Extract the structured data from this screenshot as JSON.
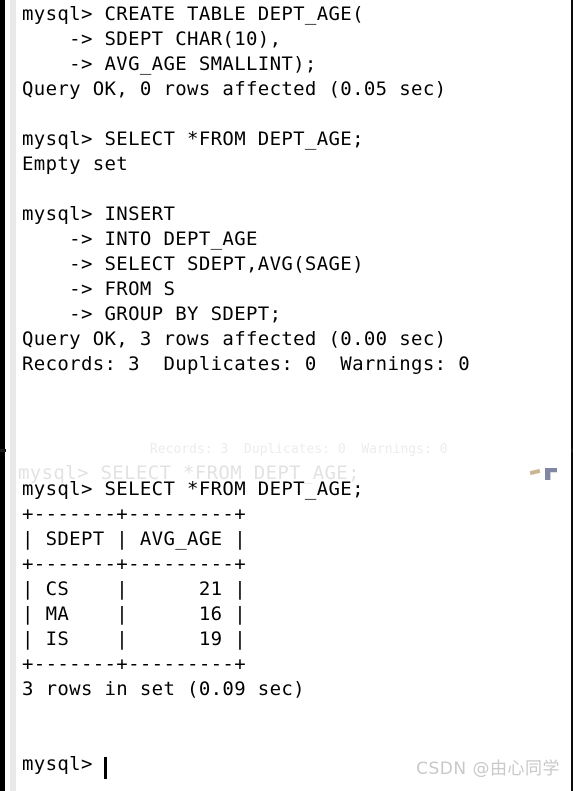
{
  "window": {
    "type": "mysql-command-line-terminal",
    "background_color": "#ffffff",
    "text_color": "#000000",
    "left_edge_color": "#000000",
    "gutter_color": "#e9e9ea",
    "right_edge_color": "#0c0c0c"
  },
  "terminal": {
    "prompt": "mysql>",
    "continuation_prompt": "->",
    "lines": [
      {
        "id": "l1",
        "text": "mysql> CREATE TABLE DEPT_AGE("
      },
      {
        "id": "l2",
        "text": "    -> SDEPT CHAR(10),"
      },
      {
        "id": "l3",
        "text": "    -> AVG_AGE SMALLINT);"
      },
      {
        "id": "l4",
        "text": "Query OK, 0 rows affected (0.05 sec)"
      },
      {
        "id": "l5",
        "text": ""
      },
      {
        "id": "l6",
        "text": "mysql> SELECT *FROM DEPT_AGE;"
      },
      {
        "id": "l7",
        "text": "Empty set"
      },
      {
        "id": "l8",
        "text": ""
      },
      {
        "id": "l9",
        "text": "mysql> INSERT"
      },
      {
        "id": "l10",
        "text": "    -> INTO DEPT_AGE"
      },
      {
        "id": "l11",
        "text": "    -> SELECT SDEPT,AVG(SAGE)"
      },
      {
        "id": "l12",
        "text": "    -> FROM S"
      },
      {
        "id": "l13",
        "text": "    -> GROUP BY SDEPT;"
      },
      {
        "id": "l14",
        "text": "Query OK, 3 rows affected (0.00 sec)"
      },
      {
        "id": "l15",
        "text": "Records: 3  Duplicates: 0  Warnings: 0"
      },
      {
        "id": "l16",
        "text": ""
      },
      {
        "id": "l17",
        "text": ""
      },
      {
        "id": "l18",
        "text": ""
      },
      {
        "id": "l19",
        "text": "mysql> SELECT *FROM DEPT_AGE;"
      },
      {
        "id": "l20",
        "text": "+-------+---------+"
      },
      {
        "id": "l21",
        "text": "| SDEPT | AVG_AGE |"
      },
      {
        "id": "l22",
        "text": "+-------+---------+"
      },
      {
        "id": "l23",
        "text": "| CS    |      21 |"
      },
      {
        "id": "l24",
        "text": "| MA    |      16 |"
      },
      {
        "id": "l25",
        "text": "| IS    |      19 |"
      },
      {
        "id": "l26",
        "text": "+-------+---------+"
      },
      {
        "id": "l27",
        "text": "3 rows in set (0.09 sec)"
      },
      {
        "id": "l28",
        "text": ""
      },
      {
        "id": "l29",
        "text": "mysql>"
      }
    ],
    "result_table": {
      "headers": [
        "SDEPT",
        "AVG_AGE"
      ],
      "rows": [
        [
          "CS",
          "21"
        ],
        [
          "MA",
          "16"
        ],
        [
          "IS",
          "19"
        ]
      ],
      "row_count_text": "3 rows in set (0.09 sec)"
    },
    "statements": [
      {
        "sql": "CREATE TABLE DEPT_AGE( SDEPT CHAR(10), AVG_AGE SMALLINT);",
        "result": "Query OK, 0 rows affected (0.05 sec)"
      },
      {
        "sql": "SELECT *FROM DEPT_AGE;",
        "result": "Empty set"
      },
      {
        "sql": "INSERT INTO DEPT_AGE SELECT SDEPT,AVG(SAGE) FROM S GROUP BY SDEPT;",
        "result": "Query OK, 3 rows affected (0.00 sec)",
        "result_extra": "Records: 3  Duplicates: 0  Warnings: 0"
      },
      {
        "sql": "SELECT *FROM DEPT_AGE;",
        "result": "3 rows in set (0.09 sec)"
      }
    ],
    "cursor_visible": true
  },
  "seam": {
    "ghost_text_1": "Records: 3  Duplicates: 0  Warnings: 0",
    "ghost_text_2": "mysql> SELECT *FROM DEPT_AGE;"
  },
  "watermark": {
    "text": "CSDN @由心同学",
    "color": "#c9c9c9"
  }
}
